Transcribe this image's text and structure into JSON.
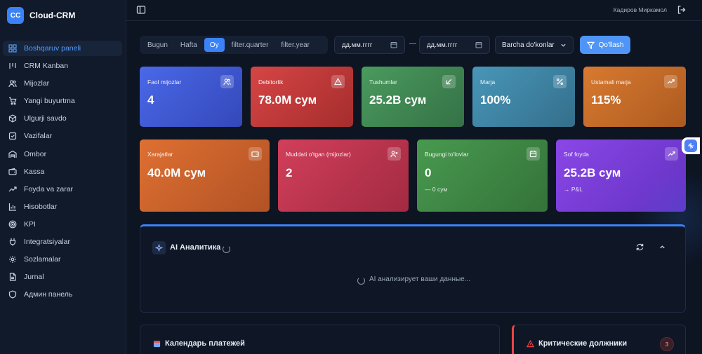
{
  "app": {
    "logo": "CC",
    "name": "Cloud-CRM"
  },
  "sidebar": {
    "items": [
      {
        "label": "Boshqaruv paneli",
        "icon": "dashboard-icon",
        "active": true
      },
      {
        "label": "CRM Kanban",
        "icon": "kanban-icon"
      },
      {
        "label": "Mijozlar",
        "icon": "users-icon"
      },
      {
        "label": "Yangi buyurtma",
        "icon": "cart-icon"
      },
      {
        "label": "Ulgurji savdo",
        "icon": "package-icon"
      },
      {
        "label": "Vazifalar",
        "icon": "tasks-icon"
      },
      {
        "label": "Ombor",
        "icon": "warehouse-icon"
      },
      {
        "label": "Kassa",
        "icon": "wallet-icon"
      },
      {
        "label": "Foyda va zarar",
        "icon": "trend-icon"
      },
      {
        "label": "Hisobotlar",
        "icon": "bar-chart-icon"
      },
      {
        "label": "KPI",
        "icon": "target-icon"
      },
      {
        "label": "Integratsiyalar",
        "icon": "plug-icon"
      },
      {
        "label": "Sozlamalar",
        "icon": "gear-icon"
      },
      {
        "label": "Jurnal",
        "icon": "file-icon"
      },
      {
        "label": "Админ панель",
        "icon": "shield-icon"
      }
    ]
  },
  "header": {
    "user": "Кадиров Миркамол"
  },
  "filters": {
    "periods": [
      "Bugun",
      "Hafta",
      "Oy",
      "filter.quarter",
      "filter.year"
    ],
    "active_period": "Oy",
    "date_from": "дд.мм.гггг",
    "date_separator": "—",
    "date_to": "дд.мм.гггг",
    "store": "Barcha do'konlar",
    "apply": "Qo'llash"
  },
  "kpi_row1": [
    {
      "label": "Faol mijozlar",
      "value": "4",
      "icon": "users-icon",
      "color": "#3d5ad6"
    },
    {
      "label": "Debitorlik",
      "value": "78.0M сум",
      "icon": "alert-icon",
      "color": "#c73a3a"
    },
    {
      "label": "Tushumlar",
      "value": "25.2B сум",
      "icon": "arrow-down-left-icon",
      "color": "#3f8a52"
    },
    {
      "label": "Marja",
      "value": "100%",
      "icon": "percent-icon",
      "color": "#3f86a5"
    },
    {
      "label": "Ustamali marja",
      "value": "115%",
      "icon": "trend-up-icon",
      "color": "#c96a27"
    }
  ],
  "kpi_row2": [
    {
      "label": "Xarajatlar",
      "value": "40.0M сум",
      "sub": "",
      "icon": "wallet-icon",
      "color": "#d0652a"
    },
    {
      "label": "Muddati o'tgan (mijozlar)",
      "value": "2",
      "sub": "",
      "icon": "user-x-icon",
      "color": "#c2374f"
    },
    {
      "label": "Bugungi to'lovlar",
      "value": "0",
      "sub": "— 0 сум",
      "icon": "calendar-icon",
      "color": "#3f8a45"
    },
    {
      "label": "Sof foyda",
      "value": "25.2B сум",
      "sub": "→ P&L",
      "icon": "trend-up-icon",
      "color": "#7a3fd6"
    }
  ],
  "ai": {
    "title": "AI Аналитика",
    "status": "AI анализирует ваши данные..."
  },
  "panels": {
    "calendar": {
      "title": "Календарь платежей",
      "icon": "calendar-icon"
    },
    "critical": {
      "title": "Критические должники",
      "count": "3",
      "icon": "alert-icon"
    }
  }
}
